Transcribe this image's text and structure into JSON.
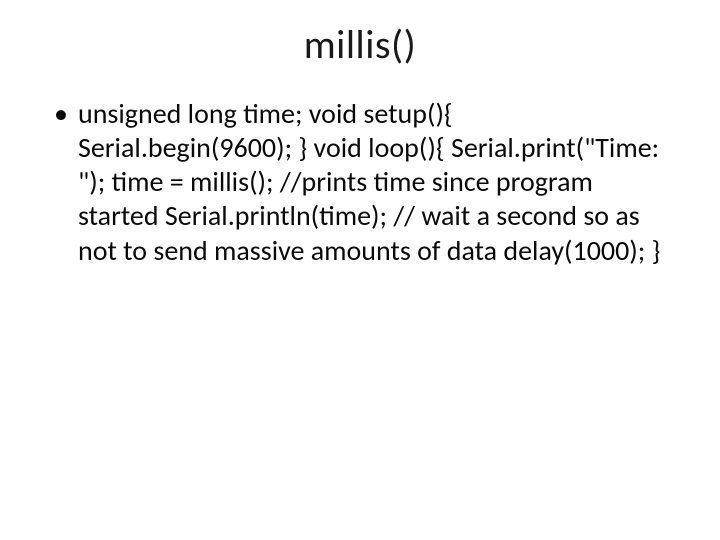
{
  "slide": {
    "title": "millis()",
    "bullets": [
      "unsigned long time; void setup(){ Serial.begin(9600); } void loop(){ Serial.print(\"Time: \"); time = millis(); //prints time since program started Serial.println(time); // wait a second so as not to send massive amounts of data delay(1000); }"
    ]
  }
}
